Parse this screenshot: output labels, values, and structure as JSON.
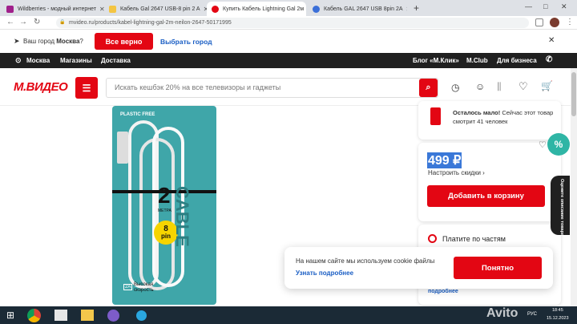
{
  "tabs": [
    {
      "label": "Wildberries - модный интернет",
      "color": "#a0208b"
    },
    {
      "label": "Кабель Gal 2647 USB-8 pin 2 A",
      "color": "#f4c542"
    },
    {
      "label": "Купить Кабель Lightning Gal 2м",
      "color": "#e30613"
    },
    {
      "label": "Кабель GAL 2647 USB 8pin 2A",
      "color": "#3b6fd8"
    }
  ],
  "browser": {
    "url": "mvideo.ru/products/kabel-lightning-gal-2m-neilon-2647-50171995",
    "new_tab": "+"
  },
  "citybar": {
    "question_prefix": "Ваш город",
    "city": "Москва",
    "question_mark": "?",
    "confirm": "Все верно",
    "choose": "Выбрать город"
  },
  "topnav": {
    "city": "Москва",
    "stores": "Магазины",
    "delivery": "Доставка",
    "blog": "Блог «М.Клик»",
    "club": "M.Club",
    "business": "Для бизнеса"
  },
  "header": {
    "logo": "М.ВИДЕО",
    "search_placeholder": "Искать кешбэк 20% на все телевизоры и гаджеты"
  },
  "product_box": {
    "brand_text": "PLASTIC FREE",
    "length_value": "2",
    "length_unit": "МЕТРА",
    "connector_top": "8",
    "connector_bottom": "pin",
    "speed": "Высокая скорость",
    "current": "2A",
    "side_text": "CABLE"
  },
  "sidebar": {
    "stock_bold": "Осталось мало!",
    "stock_rest": "Сейчас этот товар смотрит 41 человек",
    "price": "499 ₽",
    "discount": "Настроить скидки",
    "add_to_cart": "Добавить в корзину",
    "installments": "Платите по частям",
    "more_link": "подробнее"
  },
  "cookie": {
    "text": "На нашем сайте мы используем cookie файлы",
    "more": "Узнать подробнее",
    "ok": "Понятно"
  },
  "rate_tab": "Оцените описание товара",
  "badge": "%",
  "taskbar": {
    "lang": "РУС",
    "time": "18:45",
    "date": "15.12.2023"
  },
  "watermark": "Avito",
  "colors": {
    "brand_red": "#e30613",
    "link_blue": "#1a5ec4",
    "teal_bg": "#3fa6a9",
    "dark_nav": "#202020"
  }
}
